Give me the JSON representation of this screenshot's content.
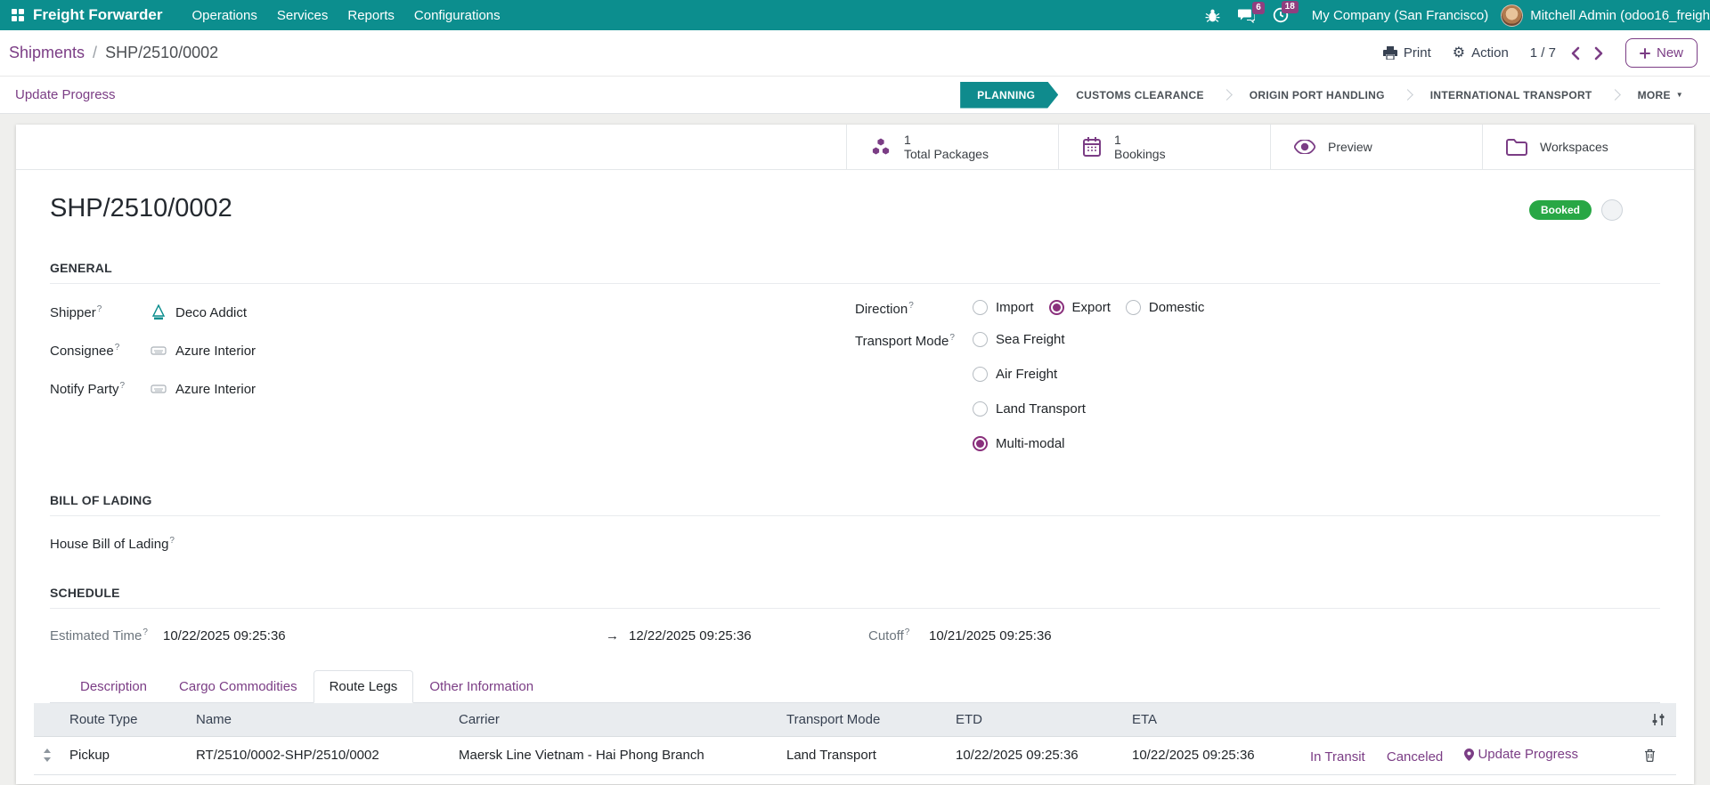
{
  "ui": {
    "help_marker": "?"
  },
  "navbar": {
    "app_name": "Freight Forwarder",
    "menus": [
      {
        "label": "Operations"
      },
      {
        "label": "Services"
      },
      {
        "label": "Reports"
      },
      {
        "label": "Configurations"
      }
    ],
    "message_badge": "6",
    "activity_badge": "18",
    "company": "My Company (San Francisco)",
    "user": "Mitchell Admin (odoo16_freigh"
  },
  "control_panel": {
    "breadcrumb": {
      "parent": "Shipments",
      "separator": "/",
      "current": "SHP/2510/0002"
    },
    "print_label": "Print",
    "action_label": "Action",
    "pager": "1 / 7",
    "new_label": "New"
  },
  "statusbar": {
    "update_progress_label": "Update Progress",
    "stages": [
      {
        "label": "PLANNING",
        "active": true
      },
      {
        "label": "CUSTOMS CLEARANCE",
        "active": false
      },
      {
        "label": "ORIGIN PORT HANDLING",
        "active": false
      },
      {
        "label": "INTERNATIONAL TRANSPORT",
        "active": false
      }
    ],
    "more_label": "MORE",
    "more_caret": "▼"
  },
  "button_box": {
    "total_packages": {
      "value": "1",
      "label": "Total Packages",
      "icon": "packages-icon"
    },
    "bookings": {
      "value": "1",
      "label": "Bookings",
      "icon": "calendar-icon"
    },
    "preview": {
      "label": "Preview",
      "icon": "eye-icon"
    },
    "workspaces": {
      "label": "Workspaces",
      "icon": "folder-icon"
    }
  },
  "record": {
    "title": "SHP/2510/0002",
    "status_badge": "Booked"
  },
  "sections": {
    "general": {
      "heading": "GENERAL",
      "fields": [
        {
          "label": "Shipper",
          "value": "Deco Addict",
          "logo": "deco-addict-logo"
        },
        {
          "label": "Consignee",
          "value": "Azure Interior",
          "logo": "azure-interior-logo"
        },
        {
          "label": "Notify Party",
          "value": "Azure Interior",
          "logo": "azure-interior-logo"
        }
      ],
      "direction": {
        "label": "Direction",
        "options": [
          {
            "label": "Import",
            "checked": false
          },
          {
            "label": "Export",
            "checked": true
          },
          {
            "label": "Domestic",
            "checked": false
          }
        ]
      },
      "transport_mode": {
        "label": "Transport Mode",
        "options": [
          {
            "label": "Sea Freight",
            "checked": false
          },
          {
            "label": "Air Freight",
            "checked": false
          },
          {
            "label": "Land Transport",
            "checked": false
          },
          {
            "label": "Multi-modal",
            "checked": true
          }
        ]
      }
    },
    "bill_of_lading": {
      "heading": "BILL OF LADING",
      "house_bl_label": "House Bill of Lading"
    },
    "schedule": {
      "heading": "SCHEDULE",
      "estimated_label": "Estimated Time",
      "start": "10/22/2025 09:25:36",
      "arrow": "→",
      "end": "12/22/2025 09:25:36",
      "cutoff_label": "Cutoff",
      "cutoff_value": "10/21/2025 09:25:36"
    }
  },
  "notebook": {
    "tabs": [
      {
        "label": "Description",
        "active": false
      },
      {
        "label": "Cargo Commodities",
        "active": false
      },
      {
        "label": "Route Legs",
        "active": true
      },
      {
        "label": "Other Information",
        "active": false
      }
    ],
    "route_legs_table": {
      "headers": {
        "route_type": "Route Type",
        "name": "Name",
        "carrier": "Carrier",
        "transport_mode": "Transport Mode",
        "etd": "ETD",
        "eta": "ETA"
      },
      "rows": [
        {
          "route_type": "Pickup",
          "name": "RT/2510/0002-SHP/2510/0002",
          "carrier": "Maersk Line Vietnam - Hai Phong Branch",
          "transport_mode": "Land Transport",
          "etd": "10/22/2025 09:25:36",
          "eta": "10/22/2025 09:25:36",
          "actions": {
            "in_transit": "In Transit",
            "canceled": "Canceled",
            "update_progress": "Update Progress"
          }
        }
      ]
    }
  },
  "colors": {
    "navbar_teal": "#0c8e8e",
    "accent_purple": "#7b3d85",
    "radio_purple": "#8a2f7c",
    "notification_badge": "#8f3f7f",
    "booked_green": "#28a745"
  }
}
